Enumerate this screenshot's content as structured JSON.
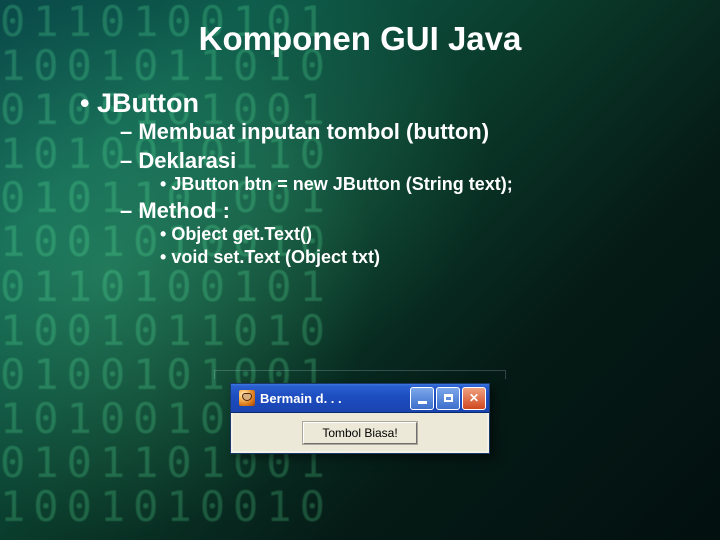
{
  "title": "Komponen GUI Java",
  "bullets": {
    "l1_1": "JButton",
    "l2_1": "Membuat inputan tombol (button)",
    "l2_2": "Deklarasi",
    "l3_decl": "JButton btn = new JButton (String text);",
    "l2_3": "Method :",
    "l3_m1": "Object get.Text()",
    "l3_m2": "void set.Text (Object txt)"
  },
  "window": {
    "title": "Bermain d. . .",
    "button_label": "Tombol Biasa!"
  },
  "digits_bg": "0110100101\n1001011010\n0100101001\n1010010110\n0101101001\n1001010010\n0110100101\n1001011010\n0100101001\n1010010110\n0101101001\n1001010010"
}
